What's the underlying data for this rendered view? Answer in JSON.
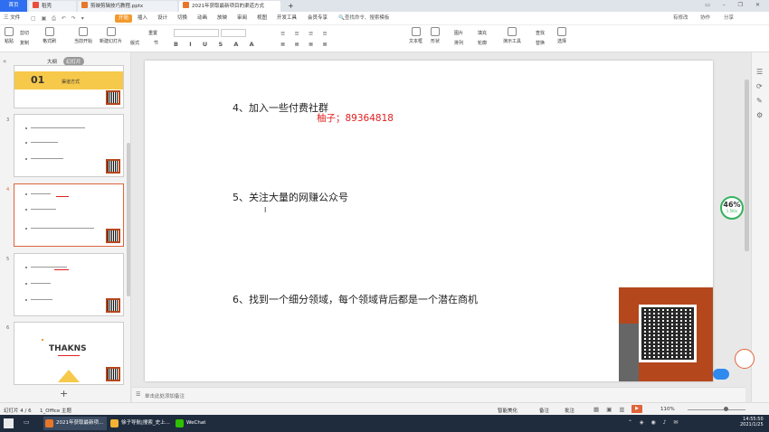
{
  "tabs": {
    "home": "首页",
    "t1": "稻壳",
    "t2": "剪映剪辑技巧教程.pptx",
    "t3": "2021年获取最新项目的渠道方式",
    "add": "+"
  },
  "menu": {
    "file": "三 文件",
    "start": "开始",
    "insert": "插入",
    "design": "设计",
    "transition": "切换",
    "animation": "动画",
    "slideshow": "放映",
    "review": "审阅",
    "view": "视图",
    "devtools": "开发工具",
    "member": "会员专享",
    "search": "查找命令、搜索模板",
    "unsaved": "有修改",
    "collab": "协作",
    "share": "分享"
  },
  "ribbon": {
    "paste": "粘贴",
    "cut": "剪切",
    "copy": "复制",
    "format_painter": "格式刷",
    "start_from_current": "当前开始",
    "new_slide": "新建幻灯片",
    "layout": "版式",
    "section": "节",
    "reset": "重置",
    "textbox": "文本框",
    "shape": "形状",
    "arrange": "排列",
    "picture": "图片",
    "fill": "填充",
    "outline": "轮廓",
    "presentation_tools": "演示工具",
    "find": "查找",
    "replace": "替换",
    "select": "选择"
  },
  "panel": {
    "outline_tab": "大纲",
    "slides_tab": "幻灯片"
  },
  "thumbs": [
    {
      "num": "",
      "title_num": "01",
      "title": "渠道方式"
    },
    {
      "num": "3"
    },
    {
      "num": "4"
    },
    {
      "num": "5"
    },
    {
      "num": "6",
      "thanks": "THAKNS"
    }
  ],
  "slide": {
    "line1": "4、加入一些付费社群",
    "contact": "柚子；89364818",
    "line2": "5、关注大量的网赚公众号",
    "line3": "6、找到一个细分领域，每个领域背后都是一个潜在商机"
  },
  "badge": {
    "percent": "46%",
    "rate": "1.5K/s"
  },
  "notes": "单击此处添加备注",
  "status": {
    "slide_info": "幻灯片 4 / 6",
    "theme": "1_Office 主题",
    "beautify": "智能美化",
    "notes_btn": "备注",
    "comment": "批注",
    "zoom": "110%"
  },
  "taskbar": {
    "t1": "2021年获取最新项...",
    "t2": "徐子导航|搜索_史上...",
    "t3": "WeChat",
    "time": "14:55:50",
    "date": "2021/1/25"
  },
  "colors": {
    "accent": "#f29a2e",
    "brand": "#b5471d",
    "red": "#e02020"
  }
}
